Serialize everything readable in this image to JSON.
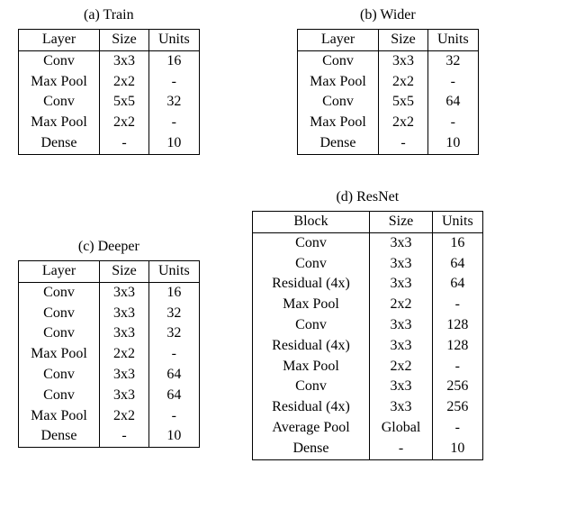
{
  "tables": {
    "a": {
      "caption": "(a) Train",
      "headers": [
        "Layer",
        "Size",
        "Units"
      ],
      "rows": [
        [
          "Conv",
          "3x3",
          "16"
        ],
        [
          "Max Pool",
          "2x2",
          "-"
        ],
        [
          "Conv",
          "5x5",
          "32"
        ],
        [
          "Max Pool",
          "2x2",
          "-"
        ],
        [
          "Dense",
          "-",
          "10"
        ]
      ]
    },
    "b": {
      "caption": "(b) Wider",
      "headers": [
        "Layer",
        "Size",
        "Units"
      ],
      "rows": [
        [
          "Conv",
          "3x3",
          "32"
        ],
        [
          "Max Pool",
          "2x2",
          "-"
        ],
        [
          "Conv",
          "5x5",
          "64"
        ],
        [
          "Max Pool",
          "2x2",
          "-"
        ],
        [
          "Dense",
          "-",
          "10"
        ]
      ]
    },
    "c": {
      "caption": "(c) Deeper",
      "headers": [
        "Layer",
        "Size",
        "Units"
      ],
      "rows": [
        [
          "Conv",
          "3x3",
          "16"
        ],
        [
          "Conv",
          "3x3",
          "32"
        ],
        [
          "Conv",
          "3x3",
          "32"
        ],
        [
          "Max Pool",
          "2x2",
          "-"
        ],
        [
          "Conv",
          "3x3",
          "64"
        ],
        [
          "Conv",
          "3x3",
          "64"
        ],
        [
          "Max Pool",
          "2x2",
          "-"
        ],
        [
          "Dense",
          "-",
          "10"
        ]
      ]
    },
    "d": {
      "caption": "(d) ResNet",
      "headers": [
        "Block",
        "Size",
        "Units"
      ],
      "rows": [
        [
          "Conv",
          "3x3",
          "16"
        ],
        [
          "Conv",
          "3x3",
          "64"
        ],
        [
          "Residual (4x)",
          "3x3",
          "64"
        ],
        [
          "Max Pool",
          "2x2",
          "-"
        ],
        [
          "Conv",
          "3x3",
          "128"
        ],
        [
          "Residual (4x)",
          "3x3",
          "128"
        ],
        [
          "Max Pool",
          "2x2",
          "-"
        ],
        [
          "Conv",
          "3x3",
          "256"
        ],
        [
          "Residual (4x)",
          "3x3",
          "256"
        ],
        [
          "Average Pool",
          "Global",
          "-"
        ],
        [
          "Dense",
          "-",
          "10"
        ]
      ]
    }
  }
}
